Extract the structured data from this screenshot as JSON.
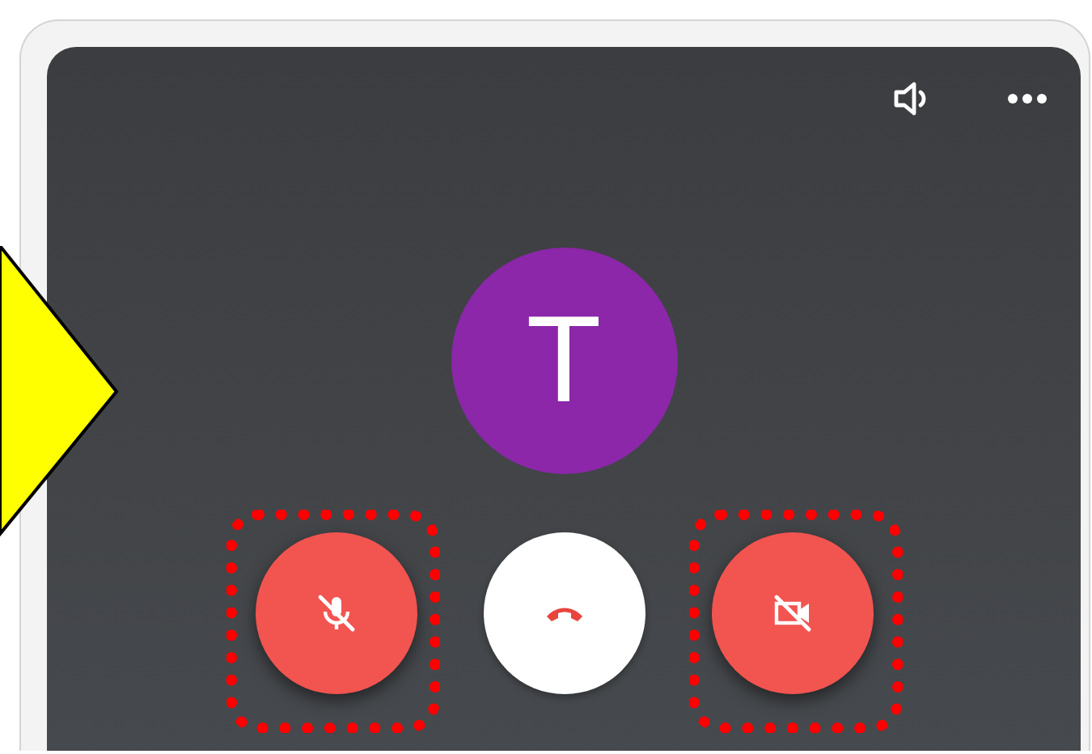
{
  "call": {
    "avatar_initial": "T",
    "show_arrow": true,
    "top_actions": [
      {
        "kind": "speaker"
      },
      {
        "kind": "more"
      }
    ],
    "controls": [
      {
        "kind": "mic",
        "muted": true,
        "highlighted": true
      },
      {
        "kind": "hangup",
        "muted": false,
        "highlighted": false
      },
      {
        "kind": "camera",
        "muted": true,
        "highlighted": true
      }
    ]
  }
}
